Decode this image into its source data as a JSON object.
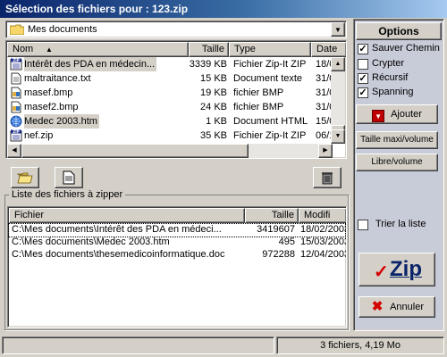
{
  "window": {
    "title": "Sélection des fichiers pour : 123.zip"
  },
  "address": {
    "value": "Mes documents",
    "icon": "folder-icon"
  },
  "file_list": {
    "columns": [
      "Nom",
      "Taille",
      "Type",
      "Date"
    ],
    "rows": [
      {
        "name": "Intérêt des PDA en médecin...",
        "size": "3339 KB",
        "type": "Fichier Zip-It ZIP",
        "date": "18/0",
        "icon": "zip-icon",
        "selected": true
      },
      {
        "name": "maltraitance.txt",
        "size": "15 KB",
        "type": "Document texte",
        "date": "31/0",
        "icon": "text-file-icon",
        "selected": false
      },
      {
        "name": "masef.bmp",
        "size": "19 KB",
        "type": "fichier BMP",
        "date": "31/0",
        "icon": "bitmap-icon",
        "selected": false
      },
      {
        "name": "masef2.bmp",
        "size": "24 KB",
        "type": "fichier BMP",
        "date": "31/0",
        "icon": "bitmap-icon",
        "selected": false
      },
      {
        "name": "Medec 2003.htm",
        "size": "1 KB",
        "type": "Document HTML",
        "date": "15/0",
        "icon": "html-file-icon",
        "selected": true
      },
      {
        "name": "nef.zip",
        "size": "35 KB",
        "type": "Fichier Zip-It ZIP",
        "date": "06/1",
        "icon": "zip-icon",
        "selected": false
      }
    ]
  },
  "toolbar": {
    "open_folder_icon": "open-folder-icon",
    "properties_icon": "document-icon",
    "delete_icon": "trash-icon"
  },
  "zip_group": {
    "label": "Liste des fichiers à zipper",
    "columns": [
      "Fichier",
      "Taille",
      "Modifi"
    ],
    "rows": [
      {
        "file": "C:\\Mes documents\\Intérêt des PDA en médeci...",
        "size": "3419607",
        "date": "18/02/2003",
        "focused": true
      },
      {
        "file": "C:\\Mes documents\\Medec 2003.htm",
        "size": "495",
        "date": "15/03/2003",
        "focused": false
      },
      {
        "file": "C:\\Mes documents\\thesemedicoinformatique.doc",
        "size": "972288",
        "date": "12/04/2003",
        "focused": false
      }
    ]
  },
  "options": {
    "title": "Options",
    "checkboxes": [
      {
        "label": "Sauver Chemin",
        "checked": true
      },
      {
        "label": "Crypter",
        "checked": false
      },
      {
        "label": "Récursif",
        "checked": true
      },
      {
        "label": "Spanning",
        "checked": true
      }
    ],
    "add_label": "Ajouter",
    "max_size_label": "Taille maxi/volume",
    "free_label": "Libre/volume",
    "sort_label": "Trier la liste",
    "sort_checked": false,
    "zip_label": "Zip",
    "cancel_label": "Annuler"
  },
  "status": {
    "summary": "3 fichiers, 4,19 Mo"
  },
  "colors": {
    "title_start": "#0a246a",
    "title_end": "#a6caf0",
    "zip_check": "#d40000",
    "zip_text": "#0a246a",
    "cancel_x": "#d40000",
    "add_arrow_bg": "#c00000"
  }
}
